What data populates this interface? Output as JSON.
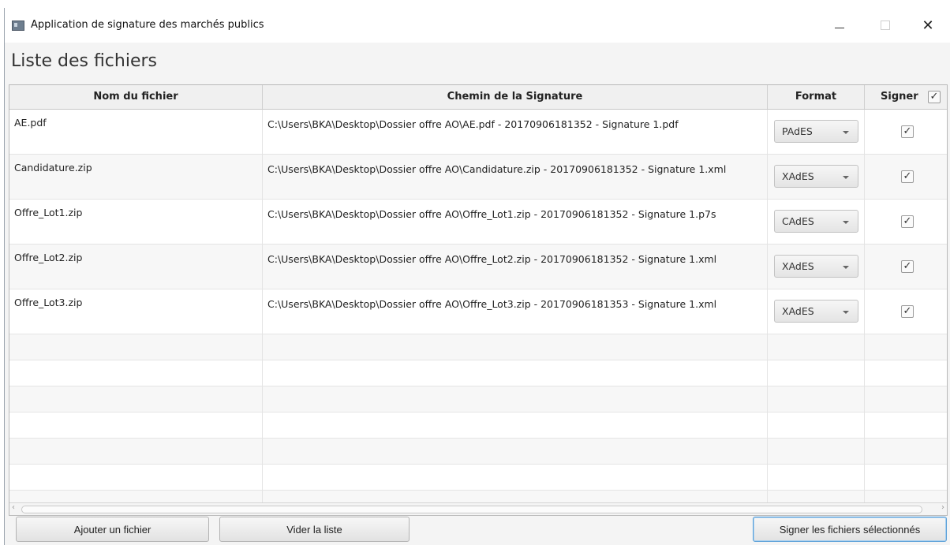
{
  "window": {
    "title": "Application de signature des marchés publics",
    "minimize_glyph": "",
    "close_glyph": "✕"
  },
  "page": {
    "heading": "Liste des fichiers"
  },
  "table": {
    "headers": {
      "name": "Nom du fichier",
      "path": "Chemin de la Signature",
      "format": "Format",
      "sign": "Signer"
    },
    "header_sign_checked": true,
    "rows": [
      {
        "name": "AE.pdf",
        "path": "C:\\Users\\BKA\\Desktop\\Dossier offre AO\\AE.pdf - 20170906181352 - Signature 1.pdf",
        "format": "PAdES",
        "checked": true
      },
      {
        "name": "Candidature.zip",
        "path": "C:\\Users\\BKA\\Desktop\\Dossier offre AO\\Candidature.zip - 20170906181352 - Signature 1.xml",
        "format": "XAdES",
        "checked": true
      },
      {
        "name": "Offre_Lot1.zip",
        "path": "C:\\Users\\BKA\\Desktop\\Dossier offre AO\\Offre_Lot1.zip - 20170906181352 - Signature 1.p7s",
        "format": "CAdES",
        "checked": true
      },
      {
        "name": "Offre_Lot2.zip",
        "path": "C:\\Users\\BKA\\Desktop\\Dossier offre AO\\Offre_Lot2.zip - 20170906181352 - Signature 1.xml",
        "format": "XAdES",
        "checked": true
      },
      {
        "name": "Offre_Lot3.zip",
        "path": "C:\\Users\\BKA\\Desktop\\Dossier offre AO\\Offre_Lot3.zip - 20170906181353 - Signature 1.xml",
        "format": "XAdES",
        "checked": true
      }
    ]
  },
  "buttons": {
    "add": "Ajouter un fichier",
    "clear": "Vider la liste",
    "sign": "Signer les fichiers sélectionnés"
  },
  "colors": {
    "focus_border": "#5aa0d8",
    "header_bg": "#f0f0f0"
  }
}
